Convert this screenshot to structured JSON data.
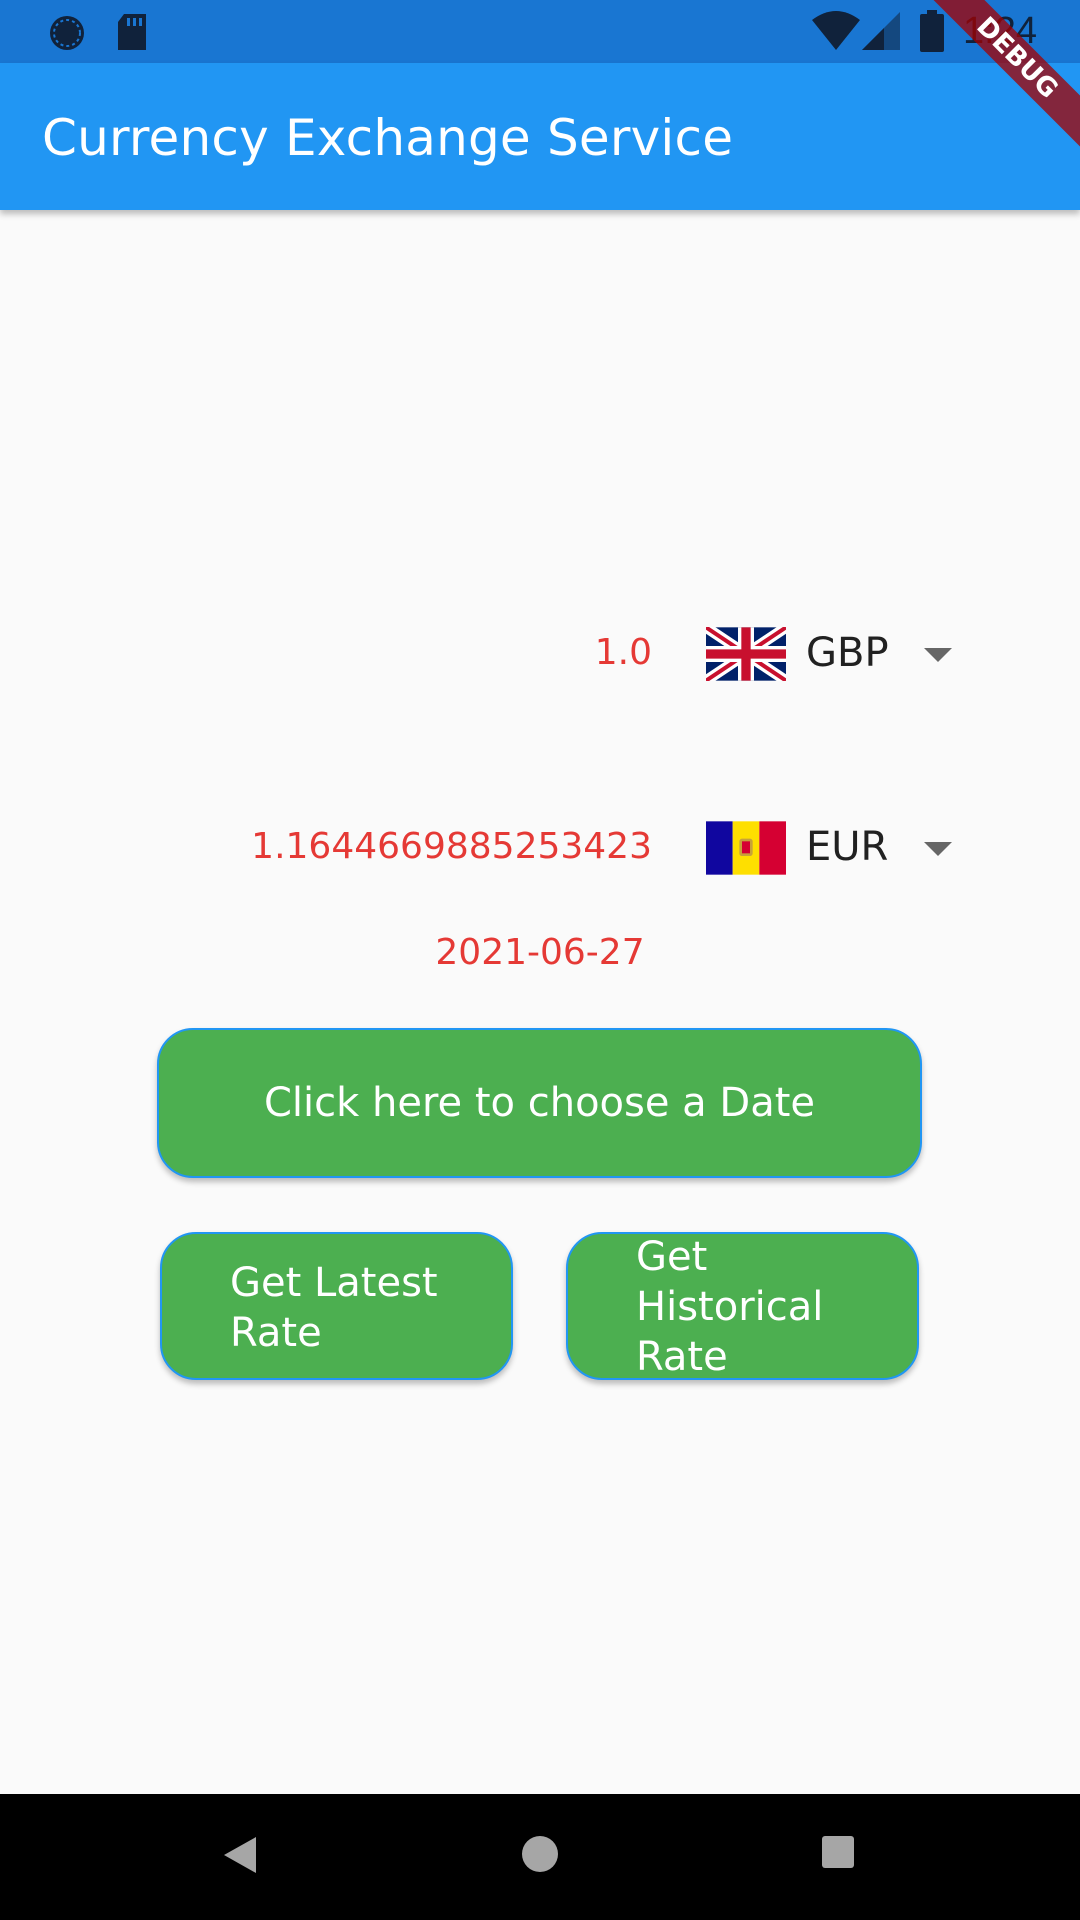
{
  "status_bar": {
    "time": "1:24",
    "left_icons": [
      "sync-icon",
      "sd-card-icon"
    ],
    "right_icons": [
      "wifi-icon",
      "signal-icon",
      "battery-icon"
    ]
  },
  "debug_banner": {
    "label": "DEBUG"
  },
  "app_bar": {
    "title": "Currency Exchange Service"
  },
  "from_currency": {
    "amount": "1.0",
    "code": "GBP",
    "flag_icon": "uk-flag-icon"
  },
  "to_currency": {
    "amount": "1.1644669885253423",
    "code": "EUR",
    "flag_icon": "andorra-flag-icon"
  },
  "selected_date": "2021-06-27",
  "buttons": {
    "choose_date": "Click here to choose a Date",
    "latest_rate": "Get Latest Rate",
    "historical_rate": "Get Historical Rate"
  },
  "nav_bar": {
    "icons": [
      "back-icon",
      "home-icon",
      "recents-icon"
    ]
  },
  "colors": {
    "status_bar": "#1976d2",
    "app_bar": "#2196f3",
    "button_fill": "#4caf50",
    "button_border": "#2196f3",
    "amount_text": "#e53935",
    "background": "#fafafa"
  }
}
